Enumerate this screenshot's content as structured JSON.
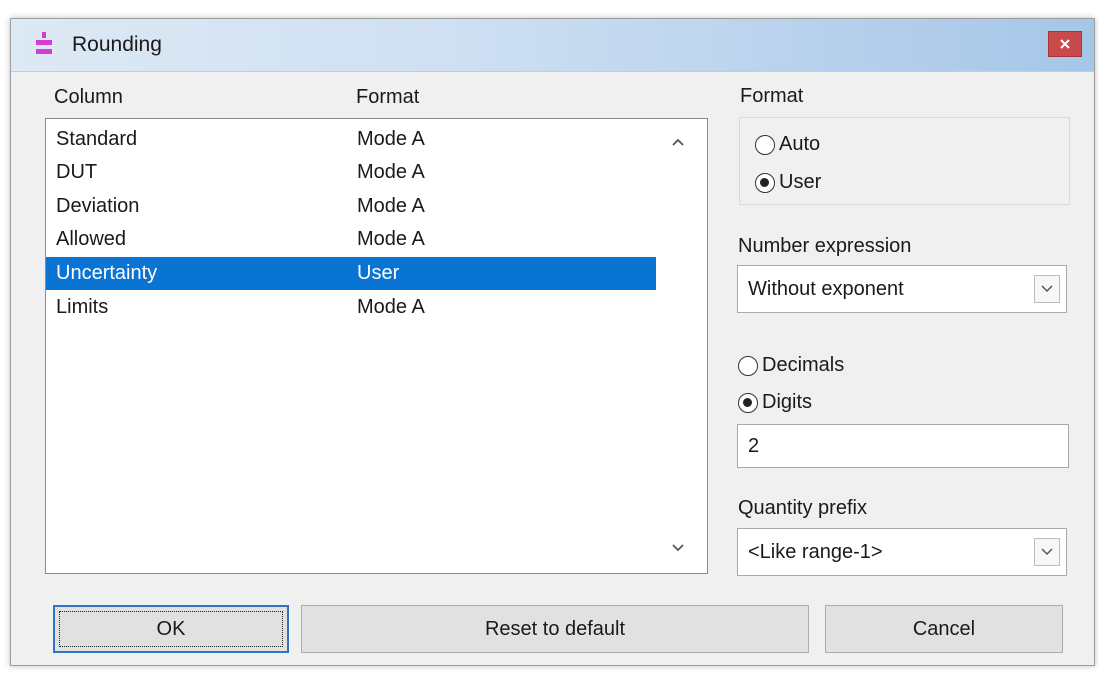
{
  "dialog": {
    "title": "Rounding",
    "icon": "rounding-app-icon",
    "close_icon": "close-icon"
  },
  "list": {
    "headers": {
      "column": "Column",
      "format": "Format"
    },
    "rows": [
      {
        "column": "Standard",
        "format": "Mode A",
        "selected": false
      },
      {
        "column": "DUT",
        "format": "Mode A",
        "selected": false
      },
      {
        "column": "Deviation",
        "format": "Mode A",
        "selected": false
      },
      {
        "column": "Allowed",
        "format": "Mode A",
        "selected": false
      },
      {
        "column": "Uncertainty",
        "format": "User",
        "selected": true
      },
      {
        "column": "Limits",
        "format": "Mode A",
        "selected": false
      }
    ]
  },
  "format_group": {
    "label": "Format",
    "options": [
      {
        "label": "Auto",
        "checked": false
      },
      {
        "label": "User",
        "checked": true
      }
    ]
  },
  "number_expression": {
    "label": "Number expression",
    "value": "Without exponent"
  },
  "precision": {
    "options": [
      {
        "label": "Decimals",
        "checked": false
      },
      {
        "label": "Digits",
        "checked": true
      }
    ],
    "value": "2"
  },
  "quantity_prefix": {
    "label": "Quantity prefix",
    "value": "<Like range-1>"
  },
  "buttons": {
    "ok": "OK",
    "reset": "Reset to default",
    "cancel": "Cancel"
  },
  "colors": {
    "selection": "#0a74d3",
    "close": "#c94a4a",
    "accent_icon": "#d63bd6",
    "default_button_border": "#2f73c8"
  }
}
